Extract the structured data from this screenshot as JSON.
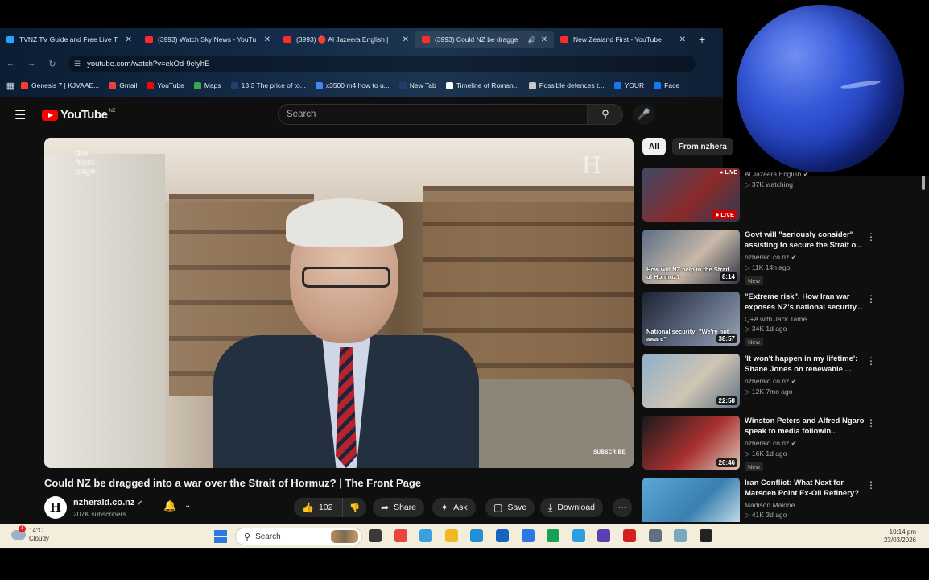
{
  "browser": {
    "tabs": [
      {
        "title": "TVNZ TV Guide and Free Live T",
        "fav_color": "#2aa0ff",
        "active": false
      },
      {
        "title": "(3993) Watch Sky News - YouTu",
        "fav_color": "#ff2a2a",
        "active": false
      },
      {
        "title": "(3993) 🔴 Al Jazeera English | ",
        "fav_color": "#ff2a2a",
        "active": false
      },
      {
        "title": "(3993) Could NZ be dragge",
        "fav_color": "#ff2a2a",
        "active": true
      },
      {
        "title": "New Zealand First - YouTube",
        "fav_color": "#ff2a2a",
        "active": false
      }
    ],
    "new_tab": "+",
    "url": "youtube.com/watch?v=ekOd-9elyhE",
    "bookmarks": [
      {
        "label": "Genesis 7 | KJVAAE...",
        "color": "#ff3b30"
      },
      {
        "label": "Gmail",
        "color": "#ea4335"
      },
      {
        "label": "YouTube",
        "color": "#ff0000"
      },
      {
        "label": "Maps",
        "color": "#34a853"
      },
      {
        "label": "13.3 The price of to...",
        "color": "#223d6e"
      },
      {
        "label": "x3500 m4 how to u...",
        "color": "#4285f4"
      },
      {
        "label": "New Tab",
        "color": "#223d6e"
      },
      {
        "label": "Timeline of Roman...",
        "color": "#ffffff"
      },
      {
        "label": "Possible defences t...",
        "color": "#c9c9c9"
      },
      {
        "label": "YOUR",
        "color": "#1877f2"
      },
      {
        "label": "Face",
        "color": "#1877f2"
      }
    ]
  },
  "youtube": {
    "logo_text": "YouTube",
    "country_code": "NZ",
    "search_placeholder": "Search",
    "video": {
      "title": "Could NZ be dragged into a war over the Strait of Hormuz? | The Front Page",
      "watermark": "the front page",
      "subscribe_overlay": "SUBSCRIBE"
    },
    "channel": {
      "name": "nzherald.co.nz",
      "subscribers": "207K subscribers"
    },
    "actions": {
      "likes": "102",
      "share": "Share",
      "ask": "Ask",
      "save": "Save",
      "download": "Download"
    },
    "chips": [
      {
        "label": "All",
        "active": true
      },
      {
        "label": "From nzhera",
        "active": false
      }
    ],
    "recommendations": [
      {
        "title": "",
        "channel": "Al Jazeera English",
        "views": "37K watching",
        "new": false,
        "live": true,
        "duration": "",
        "thumb_caption": "",
        "thumb_colors": [
          "#3a4a66",
          "#8b2a2a",
          "#2b3a52"
        ]
      },
      {
        "title": "Govt will \"seriously consider\" assisting to secure the Strait o...",
        "channel": "nzherald.co.nz",
        "views": "11K  14h ago",
        "new": true,
        "live": false,
        "duration": "8:14",
        "thumb_caption": "How will NZ help in the Strait of Hormuz?",
        "thumb_colors": [
          "#5a6f86",
          "#c9b8a8",
          "#2d3644"
        ]
      },
      {
        "title": "\"Extreme risk\". How Iran war exposes NZ's national security...",
        "channel": "Q+A with Jack Tame",
        "views": "34K  1d ago",
        "new": true,
        "live": false,
        "duration": "38:57",
        "thumb_caption": "National security: \"We're not aware\"",
        "thumb_colors": [
          "#1c2230",
          "#5c6880",
          "#9aa3b3"
        ]
      },
      {
        "title": "'It won't happen in my lifetime': Shane Jones on renewable ...",
        "channel": "nzherald.co.nz",
        "views": "12K  7mo ago",
        "new": false,
        "live": false,
        "duration": "22:58",
        "thumb_caption": "",
        "thumb_colors": [
          "#8fb0c8",
          "#d0c4b4",
          "#5d7285"
        ]
      },
      {
        "title": "Winston Peters and Alfred Ngaro speak to media followin...",
        "channel": "nzherald.co.nz",
        "views": "16K  1d ago",
        "new": true,
        "live": false,
        "duration": "26:46",
        "thumb_caption": "",
        "thumb_colors": [
          "#1a1a1a",
          "#a83030",
          "#d8c8b8"
        ]
      },
      {
        "title": "Iran Conflict: What Next for Marsden Point Ex-Oil Refinery?",
        "channel": "Madison Malone",
        "views": "41K  3d ago",
        "new": false,
        "live": false,
        "duration": "",
        "thumb_caption": "",
        "thumb_colors": [
          "#5aa8d8",
          "#3a7fb0",
          "#d8e8f0"
        ]
      }
    ]
  },
  "taskbar": {
    "weather_temp": "14°C",
    "weather_desc": "Cloudy",
    "weather_badge": "1",
    "search_label": "Search",
    "time": "10:14 pm",
    "date": "23/03/2026",
    "icons": [
      {
        "name": "task-view-icon",
        "color": "#3a3a3a"
      },
      {
        "name": "chrome-icon",
        "color": "#e8453c"
      },
      {
        "name": "copilot-icon",
        "color": "#3aa0e0"
      },
      {
        "name": "file-explorer-icon",
        "color": "#f2b824"
      },
      {
        "name": "edge-icon",
        "color": "#1f8fd6"
      },
      {
        "name": "outlook-icon",
        "color": "#1565c0"
      },
      {
        "name": "store-icon",
        "color": "#2b78e4"
      },
      {
        "name": "app-green-icon",
        "color": "#18a058"
      },
      {
        "name": "telegram-icon",
        "color": "#2aa0dd"
      },
      {
        "name": "app-purple-icon",
        "color": "#5a3fb0"
      },
      {
        "name": "flash-icon",
        "color": "#d62020"
      },
      {
        "name": "gamepad-icon",
        "color": "#607080"
      },
      {
        "name": "settings-app-icon",
        "color": "#7aa8c0"
      },
      {
        "name": "obs-icon",
        "color": "#222222"
      }
    ]
  }
}
